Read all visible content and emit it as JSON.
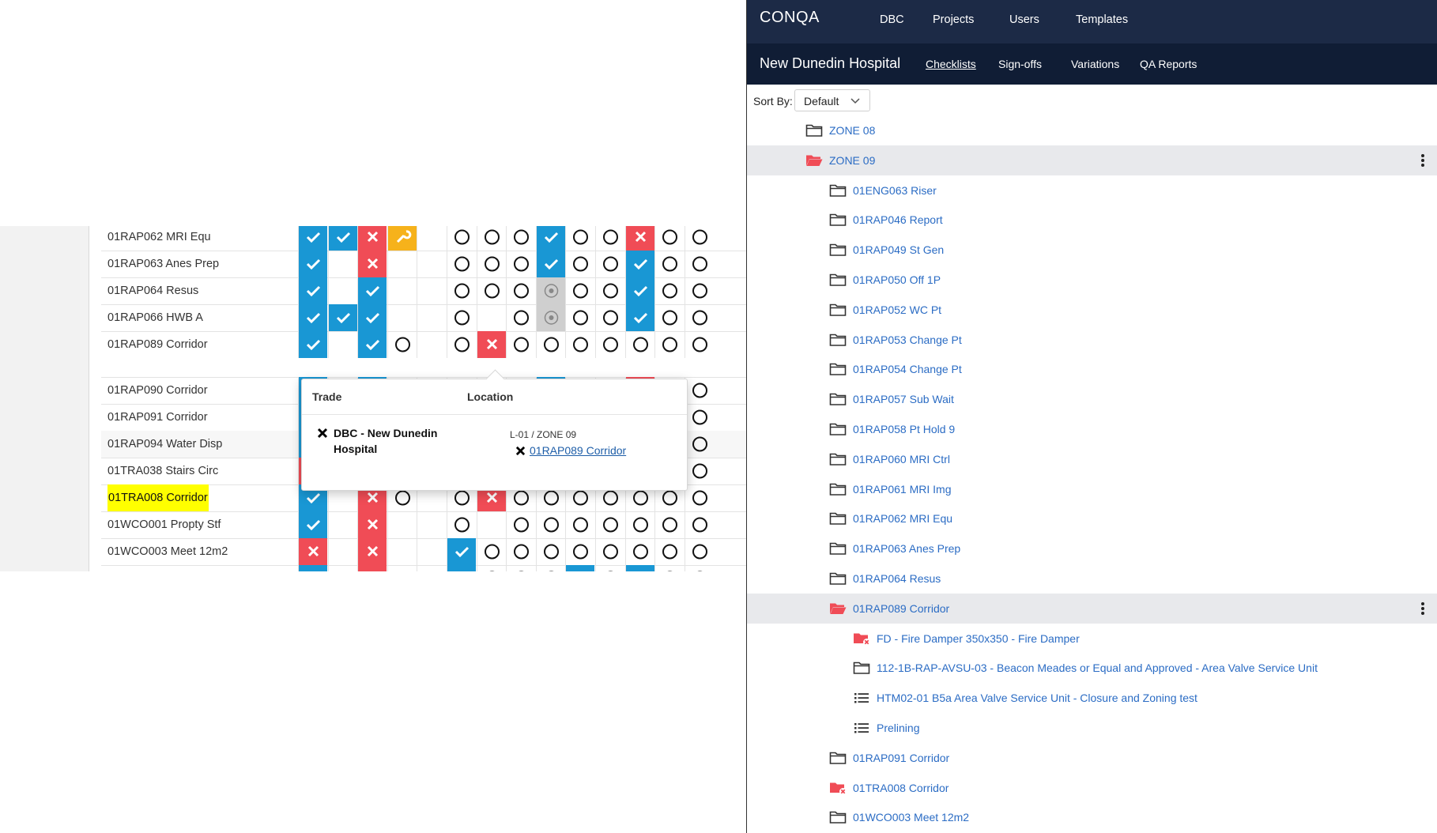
{
  "nav": {
    "brand": "CONQA",
    "items": [
      "DBC",
      "Projects",
      "Users",
      "Templates"
    ]
  },
  "project": {
    "name": "New Dunedin Hospital",
    "tabs": [
      "Checklists",
      "Sign-offs",
      "Variations",
      "QA Reports"
    ],
    "active_tab": "Checklists"
  },
  "sort": {
    "label": "Sort By:",
    "value": "Default"
  },
  "tree": [
    {
      "label": "ZONE 08",
      "depth": 1,
      "icon": "folder-icon"
    },
    {
      "label": "ZONE 09",
      "depth": 1,
      "icon": "folder-open-red-icon",
      "selected": true
    },
    {
      "label": "01ENG063 Riser",
      "depth": 2,
      "icon": "folder-icon"
    },
    {
      "label": "01RAP046 Report",
      "depth": 2,
      "icon": "folder-icon"
    },
    {
      "label": "01RAP049 St Gen",
      "depth": 2,
      "icon": "folder-icon"
    },
    {
      "label": "01RAP050 Off 1P",
      "depth": 2,
      "icon": "folder-icon"
    },
    {
      "label": "01RAP052 WC Pt",
      "depth": 2,
      "icon": "folder-icon"
    },
    {
      "label": "01RAP053 Change Pt",
      "depth": 2,
      "icon": "folder-icon"
    },
    {
      "label": "01RAP054 Change Pt",
      "depth": 2,
      "icon": "folder-icon"
    },
    {
      "label": "01RAP057 Sub Wait",
      "depth": 2,
      "icon": "folder-icon"
    },
    {
      "label": "01RAP058 Pt Hold 9",
      "depth": 2,
      "icon": "folder-icon"
    },
    {
      "label": "01RAP060 MRI Ctrl",
      "depth": 2,
      "icon": "folder-icon"
    },
    {
      "label": "01RAP061 MRI Img",
      "depth": 2,
      "icon": "folder-icon"
    },
    {
      "label": "01RAP062 MRI Equ",
      "depth": 2,
      "icon": "folder-icon"
    },
    {
      "label": "01RAP063 Anes Prep",
      "depth": 2,
      "icon": "folder-icon"
    },
    {
      "label": "01RAP064 Resus",
      "depth": 2,
      "icon": "folder-icon"
    },
    {
      "label": "01RAP089 Corridor",
      "depth": 2,
      "icon": "folder-open-red-icon",
      "selected": true
    },
    {
      "label": "FD - Fire Damper 350x350 - Fire Damper",
      "depth": 3,
      "icon": "folder-red-x-icon"
    },
    {
      "label": "112-1B-RAP-AVSU-03 - Beacon Meades or Equal and Approved - Area Valve Service Unit",
      "depth": 3,
      "icon": "folder-icon"
    },
    {
      "label": "HTM02-01 B5a Area Valve Service Unit - Closure and Zoning test",
      "depth": 3,
      "icon": "checklist-icon"
    },
    {
      "label": "Prelining",
      "depth": 3,
      "icon": "checklist-icon"
    },
    {
      "label": "01RAP091 Corridor",
      "depth": 2,
      "icon": "folder-icon"
    },
    {
      "label": "01TRA008 Corridor",
      "depth": 2,
      "icon": "folder-red-x-icon"
    },
    {
      "label": "01WCO003 Meet 12m2",
      "depth": 2,
      "icon": "folder-icon"
    }
  ],
  "grid": {
    "rows": [
      {
        "label": "01RAP062 MRI Equ",
        "cells": [
          "B",
          "B",
          "R",
          "O",
          "",
          "o",
          "o",
          "o",
          "B",
          "o",
          "o",
          "R",
          "o",
          "o"
        ]
      },
      {
        "label": "01RAP063 Anes Prep",
        "cells": [
          "B",
          "",
          "R",
          "",
          "",
          "o",
          "o",
          "o",
          "B",
          "o",
          "o",
          "B",
          "o",
          "o"
        ]
      },
      {
        "label": "01RAP064 Resus",
        "cells": [
          "B",
          "",
          "B",
          "",
          "",
          "o",
          "o",
          "o",
          "G",
          "o",
          "o",
          "B",
          "o",
          "o"
        ]
      },
      {
        "label": "01RAP066 HWB A",
        "cells": [
          "B",
          "B",
          "B",
          "",
          "",
          "o",
          "",
          "o",
          "G",
          "o",
          "o",
          "B",
          "o",
          "o"
        ]
      },
      {
        "label": "01RAP089 Corridor",
        "tall": true,
        "cells": [
          "B",
          "",
          "B",
          "o",
          "",
          "o",
          "R",
          "o",
          "o",
          "o",
          "o",
          "o",
          "o",
          "o"
        ]
      },
      {
        "label": "01RAP090 Corridor",
        "cells": [
          "B",
          "",
          "B",
          "o",
          "",
          "o",
          "o",
          "o",
          "B",
          "o",
          "o",
          "R",
          "o",
          "o"
        ]
      },
      {
        "label": "01RAP091 Corridor",
        "cells": [
          "B",
          "",
          "B",
          "o",
          "",
          "o",
          "o",
          "o",
          "B",
          "o",
          "o",
          "R",
          "o",
          "o"
        ]
      },
      {
        "label": "01RAP094 Water Disp",
        "alt": true,
        "cells": [
          "B",
          "",
          "B",
          "o",
          "",
          "o",
          "o",
          "o",
          "B",
          "o",
          "o",
          "R",
          "o",
          "o"
        ]
      },
      {
        "label": "01TRA038 Stairs Circ",
        "cells": [
          "R",
          "",
          "B",
          "o",
          "",
          "o",
          "o",
          "o",
          "B",
          "o",
          "o",
          "R",
          "o",
          "o"
        ]
      },
      {
        "label": "01TRA008 Corridor",
        "highlight": true,
        "cells": [
          "B",
          "",
          "R",
          "o",
          "",
          "o",
          "R",
          "o",
          "o",
          "o",
          "o",
          "o",
          "o",
          "o"
        ]
      },
      {
        "label": "01WCO001 Propty Stf",
        "cells": [
          "B",
          "",
          "R",
          "",
          "",
          "o",
          "",
          "o",
          "o",
          "o",
          "o",
          "o",
          "o",
          "o"
        ]
      },
      {
        "label": "01WCO003 Meet 12m2",
        "cells": [
          "R",
          "",
          "R",
          "",
          "",
          "B",
          "o",
          "o",
          "o",
          "o",
          "o",
          "o",
          "o",
          "o"
        ]
      },
      {
        "label": "",
        "cells": [
          "B",
          "",
          "R",
          "",
          "",
          "B",
          "o",
          "o",
          "o",
          "B",
          "o",
          "B",
          "o",
          "o"
        ]
      }
    ]
  },
  "popover": {
    "col_trade": "Trade",
    "col_location": "Location",
    "trade": "DBC - New Dunedin Hospital",
    "location_path": "L-01 / ZONE 09",
    "location_link": "01RAP089 Corridor"
  },
  "colors": {
    "navy": "#1c2a46",
    "navy_dark": "#101d35",
    "blue": "#1997d4",
    "red": "#f04c56",
    "orange": "#f6b21b",
    "link": "#2b6cc4"
  }
}
